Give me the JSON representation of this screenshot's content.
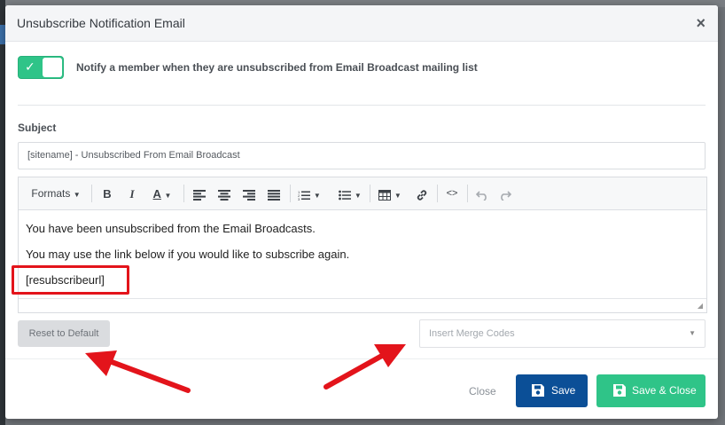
{
  "dialog": {
    "title": "Unsubscribe Notification Email",
    "close_glyph": "×"
  },
  "toggle": {
    "on": true,
    "label": "Notify a member when they are unsubscribed from Email Broadcast mailing list"
  },
  "subject": {
    "label": "Subject",
    "value": "[sitename] - Unsubscribed From Email Broadcast"
  },
  "toolbar": {
    "formats_label": "Formats",
    "bold": "B",
    "italic": "I",
    "font_color": "A",
    "icons": [
      "bold-icon",
      "italic-icon",
      "font-color-icon",
      "align-left-icon",
      "align-center-icon",
      "align-right-icon",
      "justify-icon",
      "numbered-list-icon",
      "bullet-list-icon",
      "table-icon",
      "link-icon",
      "code-icon",
      "undo-icon",
      "redo-icon"
    ]
  },
  "body": {
    "line1": "You have been unsubscribed from the Email Broadcasts.",
    "line2": "You may use the link below if you would like to subscribe again.",
    "line3": "[resubscribeurl]"
  },
  "buttons": {
    "reset": "Reset to Default",
    "merge_placeholder": "Insert Merge Codes",
    "close": "Close",
    "save": "Save",
    "save_close": "Save & Close"
  },
  "colors": {
    "accent_green": "#2fc488",
    "primary_blue": "#0b4f97",
    "annotation_red": "#e3141b"
  }
}
